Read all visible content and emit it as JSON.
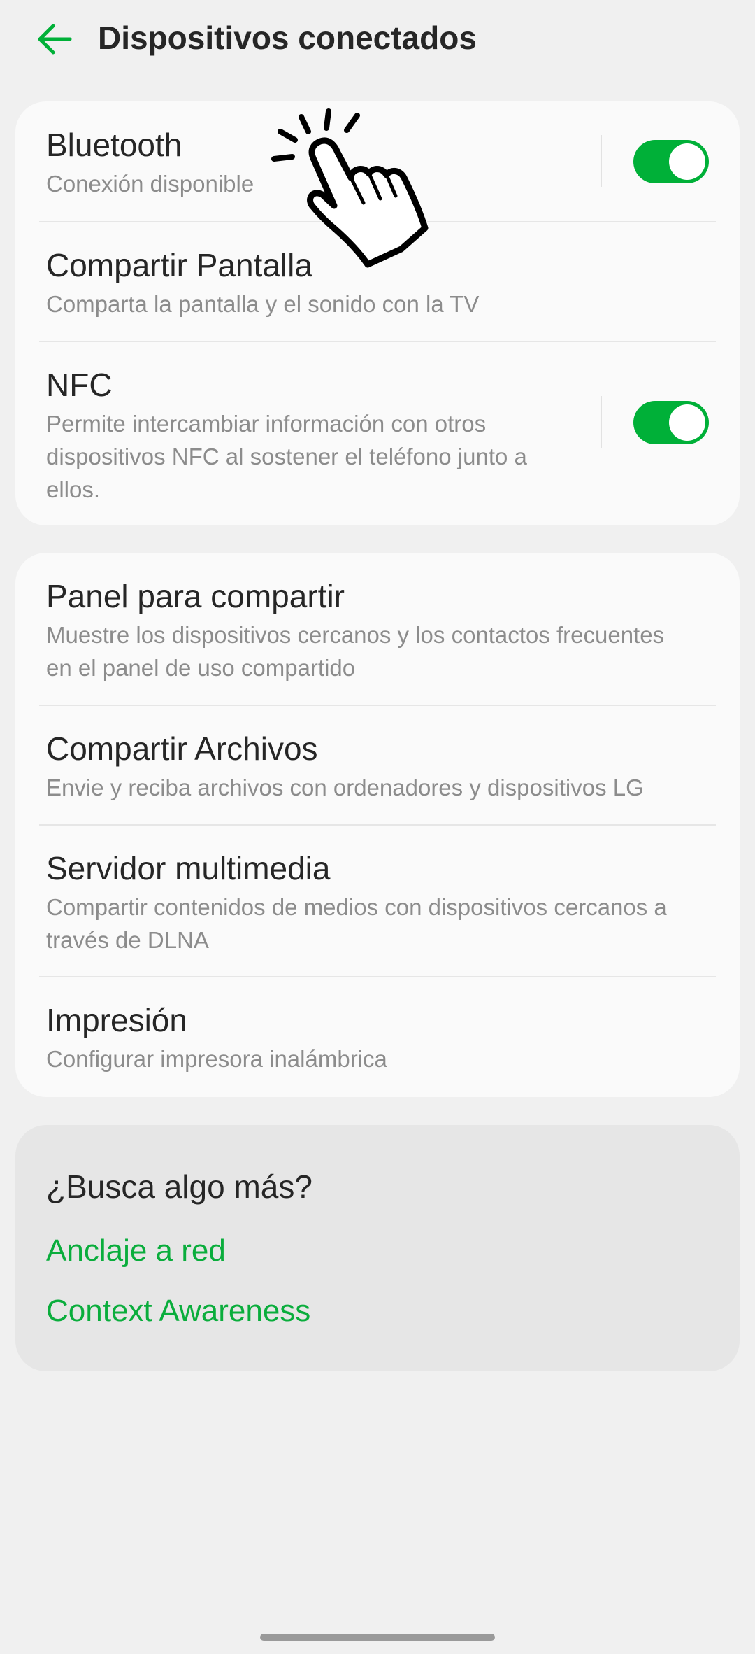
{
  "header": {
    "title": "Dispositivos conectados"
  },
  "colors": {
    "accent": "#00b038",
    "link": "#0aad3c",
    "title_text": "#262626",
    "sub_text": "#8c8c8c"
  },
  "cards": [
    {
      "items": [
        {
          "title": "Bluetooth",
          "subtitle": "Conexión disponible",
          "toggle_on": true
        },
        {
          "title": "Compartir Pantalla",
          "subtitle": "Comparta la pantalla y el sonido con la TV"
        },
        {
          "title": "NFC",
          "subtitle": "Permite intercambiar información con otros dispositivos NFC al sostener el teléfono junto a ellos.",
          "toggle_on": true
        }
      ]
    },
    {
      "items": [
        {
          "title": "Panel para compartir",
          "subtitle": "Muestre los dispositivos cercanos y los contactos frecuentes en el panel de uso compartido"
        },
        {
          "title": "Compartir Archivos",
          "subtitle": "Envie y reciba archivos con ordenadores y dispositivos LG"
        },
        {
          "title": "Servidor multimedia",
          "subtitle": "Compartir contenidos de medios con dispositivos cercanos a través de DLNA"
        },
        {
          "title": "Impresión",
          "subtitle": "Configurar impresora inalámbrica"
        }
      ]
    }
  ],
  "more": {
    "title": "¿Busca algo más?",
    "links": [
      "Anclaje a red",
      "Context Awareness"
    ]
  },
  "icons": {
    "back": "back-arrow-icon",
    "pointer": "tap-hand-icon"
  }
}
